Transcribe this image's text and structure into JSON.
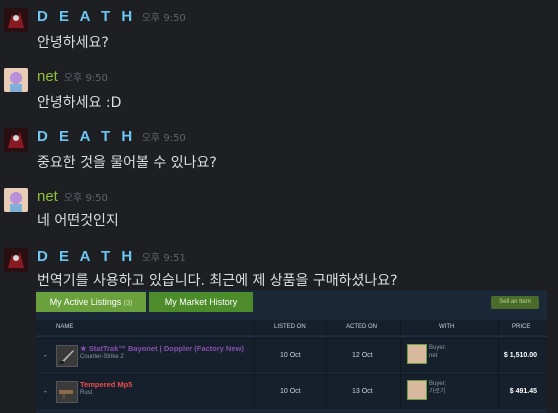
{
  "messages": [
    {
      "author": "D E A T H",
      "time": "오후 9:50",
      "text": "안녕하세요?"
    },
    {
      "author": "net",
      "time": "오후 9:50",
      "text": "안녕하세요 :D"
    },
    {
      "author": "D E A T H",
      "time": "오후 9:50",
      "text": "중요한 것을 물어볼 수 있나요?"
    },
    {
      "author": "net",
      "time": "오후 9:50",
      "text": "네 어떤것인지"
    },
    {
      "author": "D E A T H",
      "time": "오후 9:51",
      "text": "번역기를 사용하고 있습니다. 최근에 제 상품을 구매하셨나요?"
    }
  ],
  "market": {
    "tab_active_label": "My Active Listings",
    "tab_active_count": "(3)",
    "tab_history_label": "My Market History",
    "sell_button": "Sell an Item",
    "columns": [
      "NAME",
      "LISTED ON",
      "ACTED ON",
      "WITH",
      "PRICE"
    ],
    "rows": [
      {
        "dash": "-",
        "name": "★ StatTrak™ Bayonet | Doppler (Factory New)",
        "game": "Counter-Strike 2",
        "listed": "10 Oct",
        "acted": "12 Oct",
        "buyer_label": "Buyer:",
        "buyer_name": "net",
        "price": "$ 1,510.00"
      },
      {
        "dash": "-",
        "name": "Tempered Mp5",
        "game": "Rust",
        "listed": "10 Oct",
        "acted": "13 Oct",
        "buyer_label": "Buyer:",
        "buyer_name": "가로기",
        "price": "$ 491.45"
      }
    ]
  }
}
